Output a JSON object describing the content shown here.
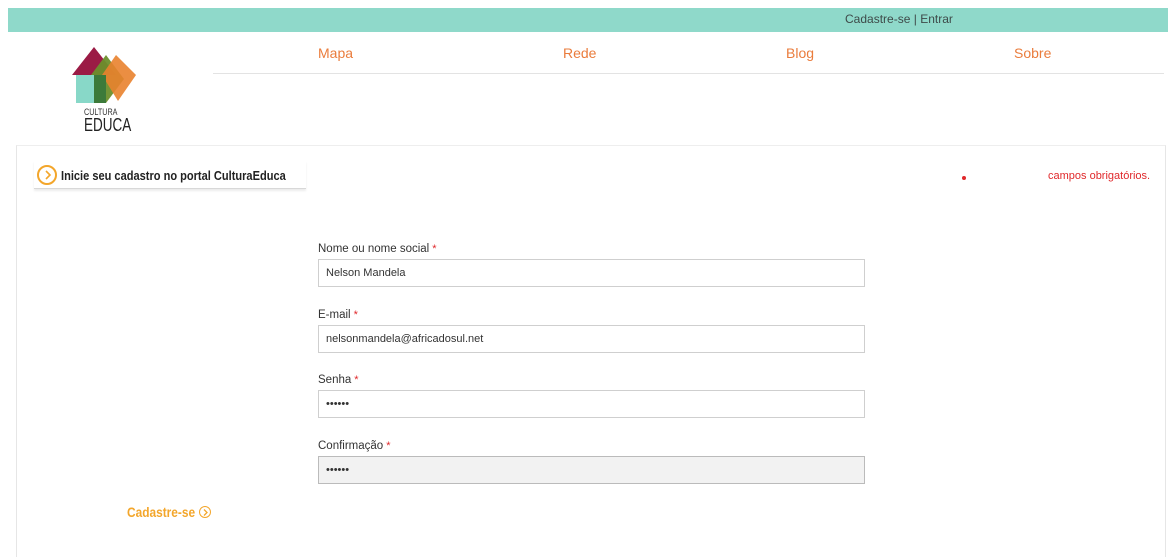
{
  "topbar": {
    "register_label": "Cadastre-se",
    "separator": "|",
    "login_label": "Entrar",
    "background_color": "#8fd9ca"
  },
  "logo": {
    "line1": "CULTURA",
    "line2": "EDUCA"
  },
  "nav": {
    "items": [
      {
        "label": "Mapa"
      },
      {
        "label": "Rede"
      },
      {
        "label": "Blog"
      },
      {
        "label": "Sobre"
      }
    ],
    "color": "#ea7c3c"
  },
  "form": {
    "heading": "Inicie seu cadastro no portal CulturaEduca",
    "required_note": "campos obrigatórios.",
    "fields": [
      {
        "label": "Nome ou nome social",
        "required": "*",
        "value": "Nelson Mandela",
        "type": "text"
      },
      {
        "label": "E-mail",
        "required": "*",
        "value": "nelsonmandela@africadosul.net",
        "type": "email"
      },
      {
        "label": "Senha",
        "required": "*",
        "value": "••••••",
        "type": "password"
      },
      {
        "label": "Confirmação",
        "required": "*",
        "value": "••••••",
        "type": "password"
      }
    ],
    "submit_label": "Cadastre-se",
    "accent_color": "#f3a62b",
    "required_color": "#e0282b"
  }
}
